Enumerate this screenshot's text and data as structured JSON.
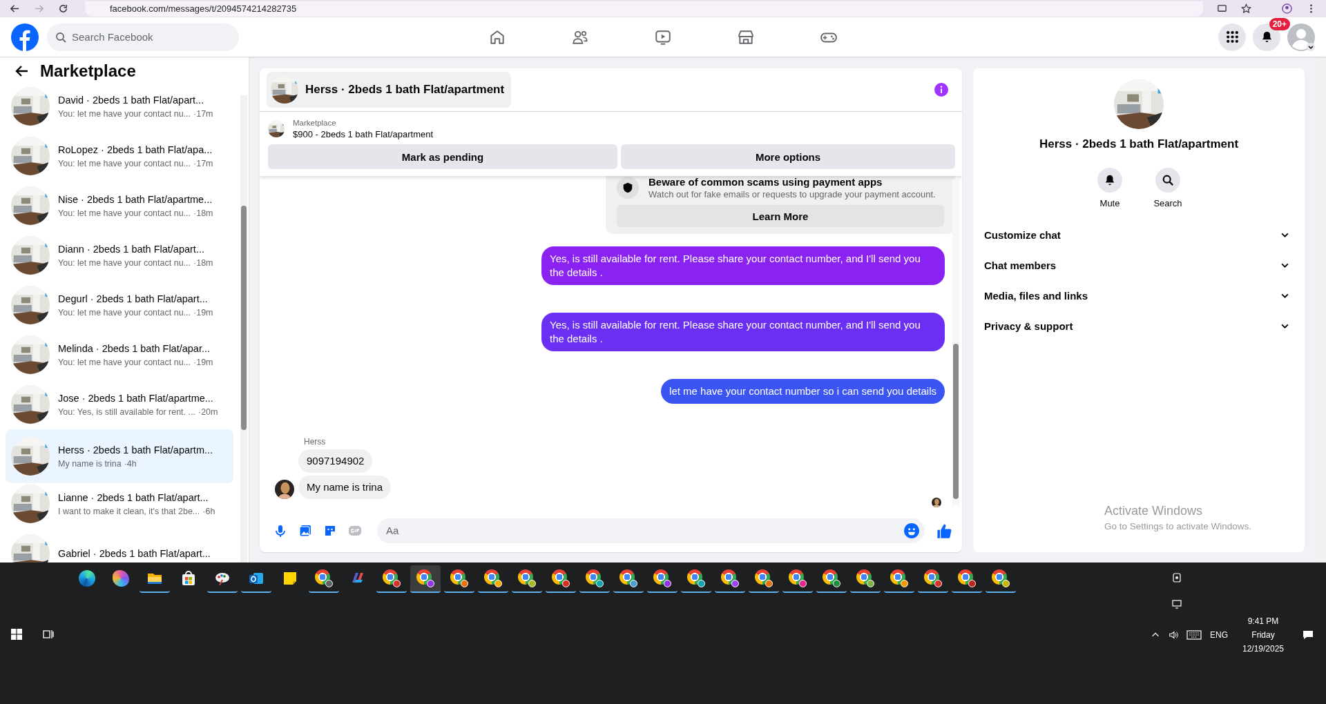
{
  "browser": {
    "url": "facebook.com/messages/t/2094574214282735"
  },
  "header": {
    "search_placeholder": "Search Facebook",
    "nav": [
      {
        "kind": "home"
      },
      {
        "kind": "friends"
      },
      {
        "kind": "video"
      },
      {
        "kind": "marketplace"
      },
      {
        "kind": "gaming"
      }
    ],
    "notification_badge": "20+"
  },
  "sidebar": {
    "title": "Marketplace",
    "conversations": [
      {
        "title": "David · 2beds 1 bath Flat/apart...",
        "preview": "You: let me have your contact nu...",
        "time": "·17m",
        "selected": false
      },
      {
        "title": "RoLopez · 2beds 1 bath Flat/apa...",
        "preview": "You: let me have your contact nu...",
        "time": "·17m",
        "selected": false
      },
      {
        "title": "Nise · 2beds 1 bath Flat/apartme...",
        "preview": "You: let me have your contact nu...",
        "time": "·18m",
        "selected": false
      },
      {
        "title": "Diann · 2beds 1 bath Flat/apart...",
        "preview": "You: let me have your contact nu...",
        "time": "·18m",
        "selected": false
      },
      {
        "title": "Degurl · 2beds 1 bath Flat/apart...",
        "preview": "You: let me have your contact nu...",
        "time": "·19m",
        "selected": false
      },
      {
        "title": "Melinda · 2beds 1 bath Flat/apar...",
        "preview": "You: let me have your contact nu...",
        "time": "·19m",
        "selected": false
      },
      {
        "title": "Jose · 2beds 1 bath Flat/apartme...",
        "preview": "You: Yes, is still available for rent. ...",
        "time": "·20m",
        "selected": false
      },
      {
        "title": "Herss · 2beds 1 bath Flat/apartm...",
        "preview": "My name is trina",
        "time": "·4h",
        "selected": true
      },
      {
        "title": "Lianne · 2beds 1 bath Flat/apart...",
        "preview": "I want to make it clean, it's that 2be...",
        "time": "·6h",
        "selected": false
      },
      {
        "title": "Gabriel · 2beds 1 bath Flat/apart...",
        "selected": false
      }
    ]
  },
  "chat": {
    "title": "Herss · 2beds 1 bath Flat/apartment",
    "listing": {
      "source": "Marketplace",
      "title": "$900 - 2beds 1 bath Flat/apartment"
    },
    "actions": [
      "Mark as pending",
      "More options"
    ],
    "messages": [
      {
        "kind": "notice",
        "title": "Beware of common scams using payment apps",
        "text": "Watch out for fake emails or requests to upgrade your payment account.",
        "button": "Learn More"
      },
      {
        "kind": "outgoing",
        "text": "Yes, is still available for rent. Please share your contact number, and I'll send you the details .",
        "color": "#8a22f2"
      },
      {
        "kind": "outgoing",
        "text": "Yes, is still available for rent. Please share your contact number, and I'll send you the details .",
        "color": "#6a2ff2"
      },
      {
        "kind": "outgoing",
        "text": "let me have your contact number so i can send you details",
        "color": "#3a55f2"
      },
      {
        "kind": "incoming",
        "sender": "Herss",
        "texts": [
          "9097194902",
          "My name is trina"
        ]
      }
    ],
    "composer": {
      "placeholder": "Aa"
    }
  },
  "details": {
    "title": "Herss · 2beds 1 bath Flat/apartment",
    "actions": [
      {
        "kind": "mute",
        "label": "Mute"
      },
      {
        "kind": "search",
        "label": "Search"
      }
    ],
    "sections": [
      {
        "label": "Customize chat",
        "expanded": false
      },
      {
        "label": "Chat members",
        "expanded": false
      },
      {
        "label": "Media, files and links",
        "expanded": false
      },
      {
        "label": "Privacy & support",
        "expanded": false
      }
    ]
  },
  "windows_notice": {
    "title": "Activate Windows",
    "text": "Go to Settings to activate Windows."
  },
  "taskbar": {
    "apps": [
      {
        "kind": "edge",
        "open": false,
        "selected": false
      },
      {
        "kind": "copilot",
        "open": false,
        "selected": false
      },
      {
        "kind": "explorer",
        "open": true,
        "selected": false
      },
      {
        "kind": "store",
        "open": false,
        "selected": false
      },
      {
        "kind": "paint",
        "open": true,
        "selected": false
      },
      {
        "kind": "outlook",
        "open": true,
        "selected": false
      },
      {
        "kind": "notes",
        "open": false,
        "selected": false
      },
      {
        "kind": "chrome",
        "color": "#5f6368",
        "open": true,
        "selected": false
      },
      {
        "kind": "m365",
        "open": false,
        "selected": false
      },
      {
        "kind": "chrome",
        "color": "#d93025",
        "open": true,
        "selected": false
      },
      {
        "kind": "chrome",
        "color": "#9334e6",
        "open": true,
        "selected": true
      },
      {
        "kind": "chrome",
        "color": "#e8710a",
        "open": true,
        "selected": false
      },
      {
        "kind": "chrome",
        "color": "#f9ab00",
        "open": true,
        "selected": false
      },
      {
        "kind": "chrome",
        "color": "#a8b820",
        "open": true,
        "selected": false
      },
      {
        "kind": "chrome",
        "color": "#d93025",
        "open": true,
        "selected": false
      },
      {
        "kind": "chrome",
        "color": "#12a4af",
        "open": true,
        "selected": false
      },
      {
        "kind": "chrome",
        "color": "#4f9ecf",
        "open": true,
        "selected": false
      },
      {
        "kind": "chrome",
        "color": "#9334e6",
        "open": true,
        "selected": false
      },
      {
        "kind": "chrome",
        "color": "#12a4af",
        "open": true,
        "selected": false
      },
      {
        "kind": "chrome",
        "color": "#a142f4",
        "open": true,
        "selected": false
      },
      {
        "kind": "chrome",
        "color": "#e8710a",
        "open": true,
        "selected": false
      },
      {
        "kind": "chrome",
        "color": "#e52592",
        "open": true,
        "selected": false
      },
      {
        "kind": "chrome",
        "color": "#1e8e3e",
        "open": true,
        "selected": false
      },
      {
        "kind": "chrome",
        "color": "#7cb342",
        "open": true,
        "selected": false
      },
      {
        "kind": "chrome",
        "color": "#f29900",
        "open": true,
        "selected": false
      },
      {
        "kind": "chrome",
        "color": "#d93025",
        "open": true,
        "selected": false
      },
      {
        "kind": "chrome",
        "color": "#c5221f",
        "open": true,
        "selected": false
      },
      {
        "kind": "chrome",
        "color": "#c9b400",
        "open": true,
        "selected": false
      }
    ],
    "language": "ENG",
    "time": "9:41 PM",
    "day": "Friday",
    "date": "12/19/2025"
  }
}
